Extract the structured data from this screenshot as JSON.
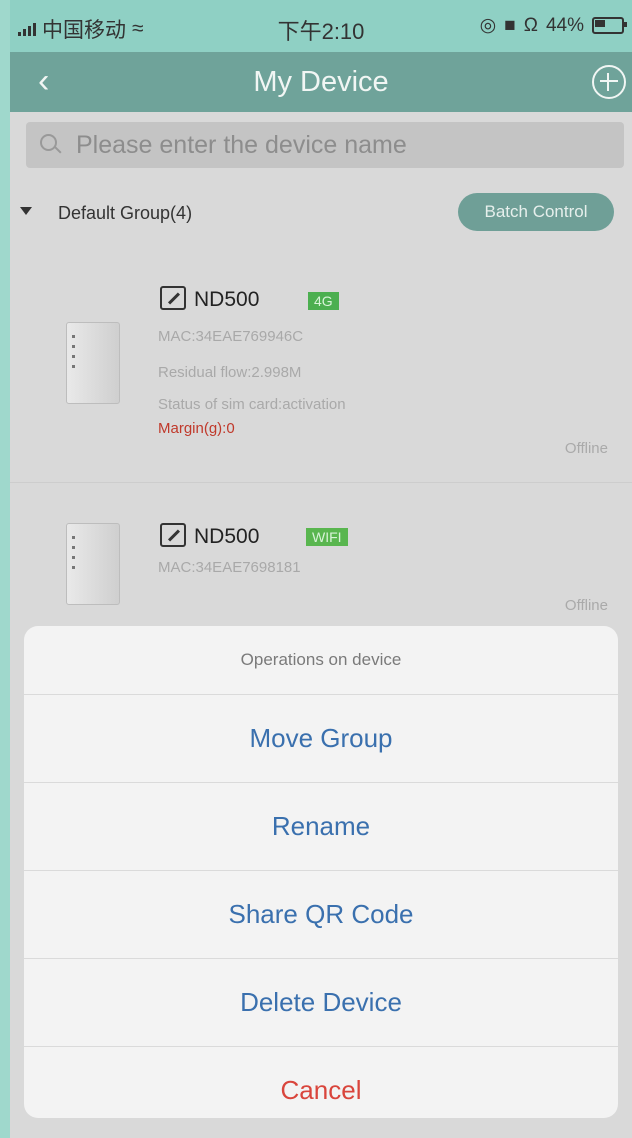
{
  "status_bar": {
    "carrier": "中国移动",
    "time": "下午2:10",
    "battery": "44%"
  },
  "nav": {
    "title": "My Device"
  },
  "search": {
    "placeholder": "Please enter the device name"
  },
  "group": {
    "name": "Default Group(4)",
    "batch_label": "Batch Control"
  },
  "devices": [
    {
      "name": "ND500",
      "tag": "4G",
      "mac": "MAC:34EAE769946C",
      "flow": "Residual flow:2.998M",
      "sim": "Status of sim card:activation",
      "margin": "Margin(g):0",
      "status": "Offline"
    },
    {
      "name": "ND500",
      "tag": "WIFI",
      "mac": "MAC:34EAE7698181",
      "status": "Offline"
    }
  ],
  "sheet": {
    "title": "Operations on device",
    "options": [
      "Move Group",
      "Rename",
      "Share QR Code",
      "Delete Device"
    ],
    "cancel": "Cancel"
  }
}
